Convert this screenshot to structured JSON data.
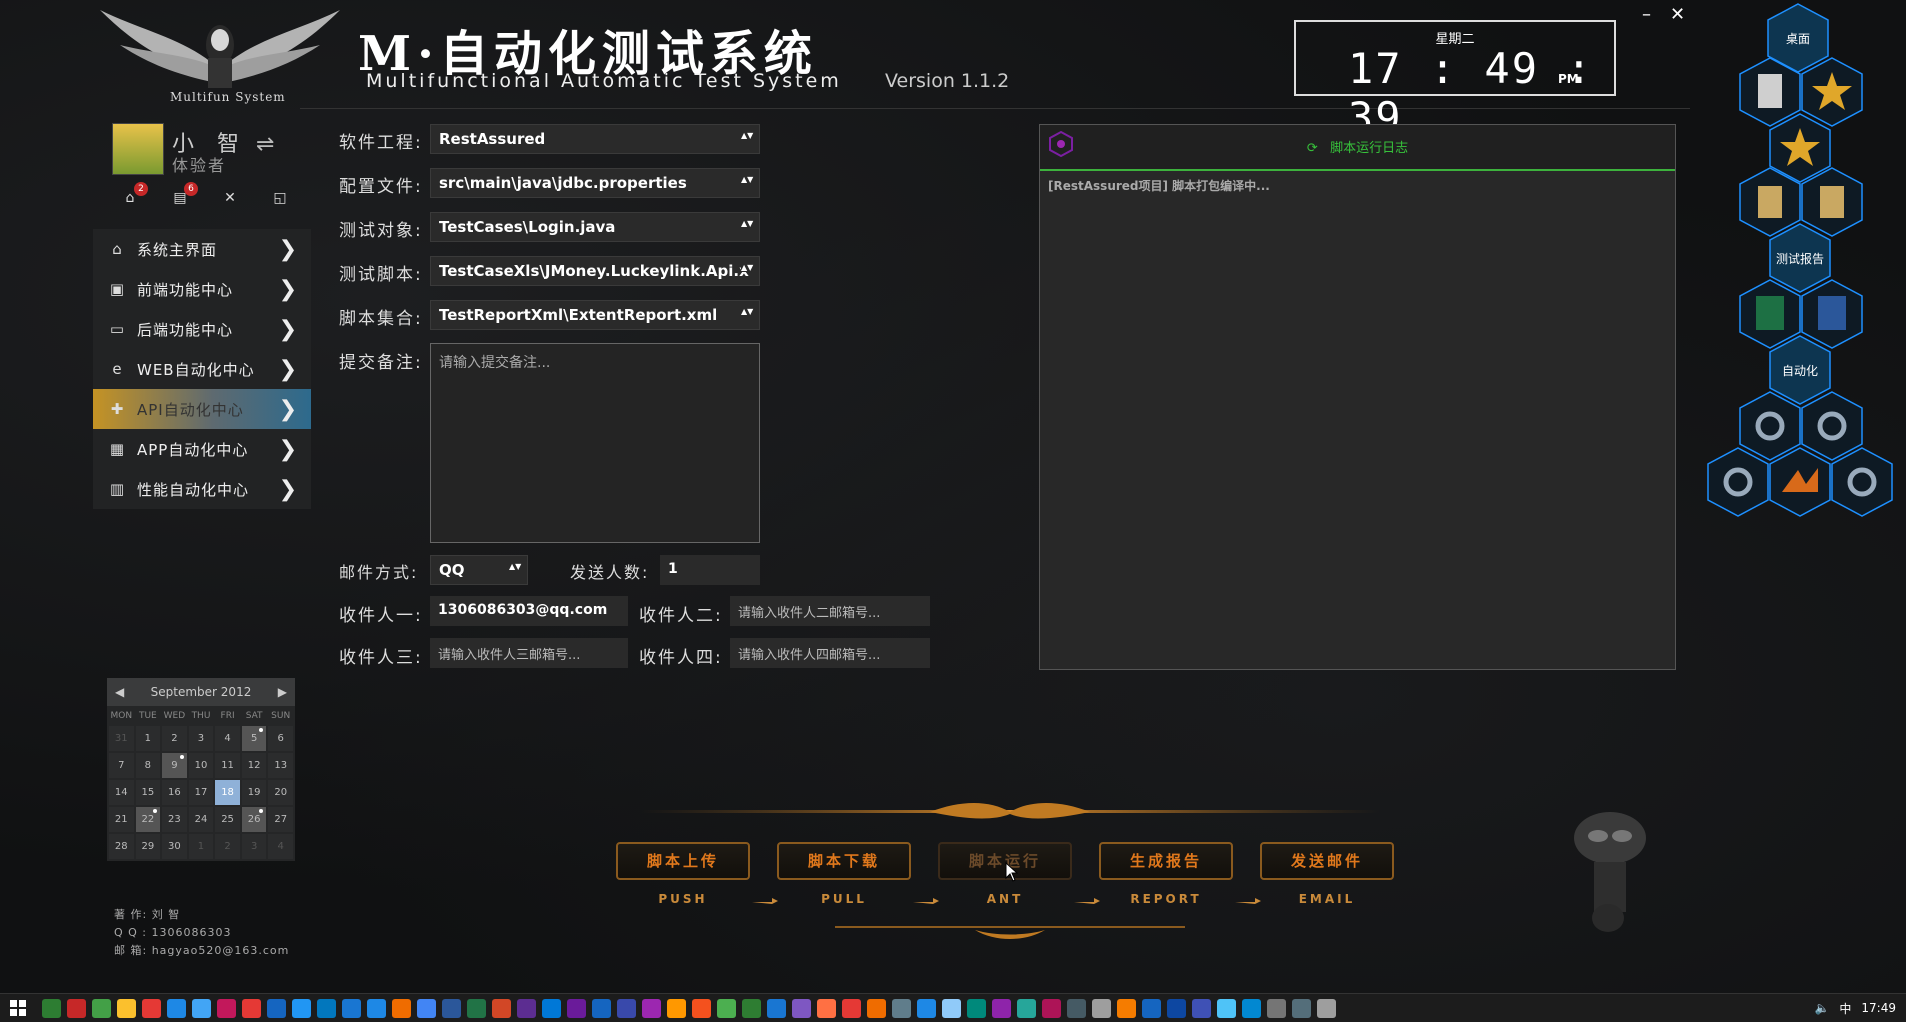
{
  "brand": {
    "subtitle": "Multifun System",
    "title": "M·自动化测试系统",
    "title_en": "Multifunctional Automatic Test System",
    "version": "Version 1.1.2"
  },
  "window": {
    "minimize": "–",
    "close": "✕"
  },
  "clock": {
    "weekday": "星期二",
    "time": "17 : 49 : 39",
    "ampm": "PM"
  },
  "user": {
    "name": "小 智",
    "role": "体验者",
    "switch_glyph": "⇌",
    "icons": [
      {
        "name": "inbox-icon",
        "glyph": "⌂",
        "badge": "2"
      },
      {
        "name": "list-icon",
        "glyph": "▤",
        "badge": "6"
      },
      {
        "name": "tools-icon",
        "glyph": "✕",
        "badge": ""
      },
      {
        "name": "chart-icon",
        "glyph": "◱",
        "badge": ""
      }
    ]
  },
  "menu": [
    {
      "label": "系统主界面",
      "icon": "home-icon",
      "glyph": "⌂",
      "active": false
    },
    {
      "label": "前端功能中心",
      "icon": "html5-icon",
      "glyph": "▣",
      "active": false
    },
    {
      "label": "后端功能中心",
      "icon": "monitor-icon",
      "glyph": "▭",
      "active": false
    },
    {
      "label": "WEB自动化中心",
      "icon": "ie-icon",
      "glyph": "e",
      "active": false
    },
    {
      "label": "API自动化中心",
      "icon": "plugin-icon",
      "glyph": "✚",
      "active": true
    },
    {
      "label": "APP自动化中心",
      "icon": "app-icon",
      "glyph": "▦",
      "active": false
    },
    {
      "label": "性能自动化中心",
      "icon": "bars-icon",
      "glyph": "▥",
      "active": false
    }
  ],
  "menu_chevron": "❯",
  "calendar": {
    "month": "September 2012",
    "prev": "◀",
    "next": "▶",
    "dow": [
      "MON",
      "TUE",
      "WED",
      "THU",
      "FRI",
      "SAT",
      "SUN"
    ],
    "cells": [
      {
        "d": "31",
        "muted": true
      },
      {
        "d": "1"
      },
      {
        "d": "2"
      },
      {
        "d": "3"
      },
      {
        "d": "4"
      },
      {
        "d": "5",
        "marked": true,
        "dot": true
      },
      {
        "d": "6"
      },
      {
        "d": "7"
      },
      {
        "d": "8"
      },
      {
        "d": "9",
        "marked": true,
        "dot": true
      },
      {
        "d": "10"
      },
      {
        "d": "11"
      },
      {
        "d": "12"
      },
      {
        "d": "13"
      },
      {
        "d": "14"
      },
      {
        "d": "15"
      },
      {
        "d": "16"
      },
      {
        "d": "17"
      },
      {
        "d": "18",
        "today": true
      },
      {
        "d": "19"
      },
      {
        "d": "20"
      },
      {
        "d": "21"
      },
      {
        "d": "22",
        "marked": true,
        "dot": true
      },
      {
        "d": "23"
      },
      {
        "d": "24"
      },
      {
        "d": "25"
      },
      {
        "d": "26",
        "marked": true,
        "dot": true
      },
      {
        "d": "27"
      },
      {
        "d": "28"
      },
      {
        "d": "29"
      },
      {
        "d": "30"
      },
      {
        "d": "1",
        "muted": true
      },
      {
        "d": "2",
        "muted": true
      },
      {
        "d": "3",
        "muted": true
      },
      {
        "d": "4",
        "muted": true
      }
    ]
  },
  "author": {
    "line1": "著 作:  刘 智",
    "line2": "Q Q :   1306086303",
    "line3": "邮 箱:  hagyao520@163.com"
  },
  "form": {
    "project_label": "软件工程:",
    "project_value": "RestAssured",
    "config_label": "配置文件:",
    "config_value": "src\\main\\java\\jdbc.properties",
    "target_label": "测试对象:",
    "target_value": "TestCases\\Login.java",
    "script_label": "测试脚本:",
    "script_value": "TestCaseXls\\JMoney.Luckeylink.Api.x",
    "suite_label": "脚本集合:",
    "suite_value": "TestReportXml\\ExtentReport.xml",
    "remark_label": "提交备注:",
    "remark_placeholder": "请输入提交备注...",
    "mail_label": "邮件方式:",
    "mail_value": "QQ",
    "count_label": "发送人数:",
    "count_value": "1",
    "r1_label": "收件人一:",
    "r1_value": "1306086303@qq.com",
    "r2_label": "收件人二:",
    "r2_placeholder": "请输入收件人二邮箱号...",
    "r3_label": "收件人三:",
    "r3_placeholder": "请输入收件人三邮箱号...",
    "r4_label": "收件人四:",
    "r4_placeholder": "请输入收件人四邮箱号...",
    "arrow": "▲▼"
  },
  "log": {
    "title": "脚本运行日志",
    "refresh": "⟳",
    "line": "[RestAssured项目] 脚本打包编译中..."
  },
  "launcher": [
    {
      "label": "桌面",
      "kind": "title"
    },
    {
      "label": "",
      "kind": "doc-icon"
    },
    {
      "label": "",
      "kind": "star-icon"
    },
    {
      "label": "",
      "kind": "star-icon"
    },
    {
      "label": "",
      "kind": "folder-icon"
    },
    {
      "label": "",
      "kind": "folder-icon"
    },
    {
      "label": "测试报告",
      "kind": "title"
    },
    {
      "label": "",
      "kind": "excel-icon"
    },
    {
      "label": "",
      "kind": "word-icon"
    },
    {
      "label": "自动化",
      "kind": "title"
    },
    {
      "label": "",
      "kind": "gear-icon"
    },
    {
      "label": "",
      "kind": "gear-icon"
    },
    {
      "label": "",
      "kind": "gear-icon"
    },
    {
      "label": "",
      "kind": "matlab-icon"
    },
    {
      "label": "",
      "kind": "gear-icon"
    }
  ],
  "actions": [
    {
      "label": "脚本上传",
      "sub": "PUSH",
      "dim": false
    },
    {
      "label": "脚本下载",
      "sub": "PULL",
      "dim": false
    },
    {
      "label": "脚本运行",
      "sub": "ANT",
      "dim": true
    },
    {
      "label": "生成报告",
      "sub": "REPORT",
      "dim": false
    },
    {
      "label": "发送邮件",
      "sub": "EMAIL",
      "dim": false
    }
  ],
  "taskbar": {
    "ime": "中",
    "time": "17:49",
    "icon_colors": [
      "#2d7d32",
      "#c62828",
      "#43a047",
      "#fbc02d",
      "#e53935",
      "#1e88e5",
      "#42a5f5",
      "#c2185b",
      "#e53935",
      "#1565c0",
      "#2196f3",
      "#0277bd",
      "#1976d2",
      "#1e88e5",
      "#ef6c00",
      "#4285f4",
      "#2b579a",
      "#217346",
      "#d24726",
      "#5c2d91",
      "#0078d7",
      "#6a1b9a",
      "#1565c0",
      "#3949ab",
      "#9c27b0",
      "#ff9800",
      "#f4511e",
      "#4caf50",
      "#2e7d32",
      "#1976d2",
      "#7e57c2",
      "#ff7043",
      "#e53935",
      "#ef6c00",
      "#607d8b",
      "#1e88e5",
      "#90caf9",
      "#00897b",
      "#8e24aa",
      "#26a69a",
      "#ad1457",
      "#455a64",
      "#9e9e9e",
      "#f57c00",
      "#1565c0",
      "#0d47a1",
      "#3f51b5",
      "#4fc3f7",
      "#0288d1",
      "#757575",
      "#546e7a",
      "#9e9e9e"
    ]
  }
}
